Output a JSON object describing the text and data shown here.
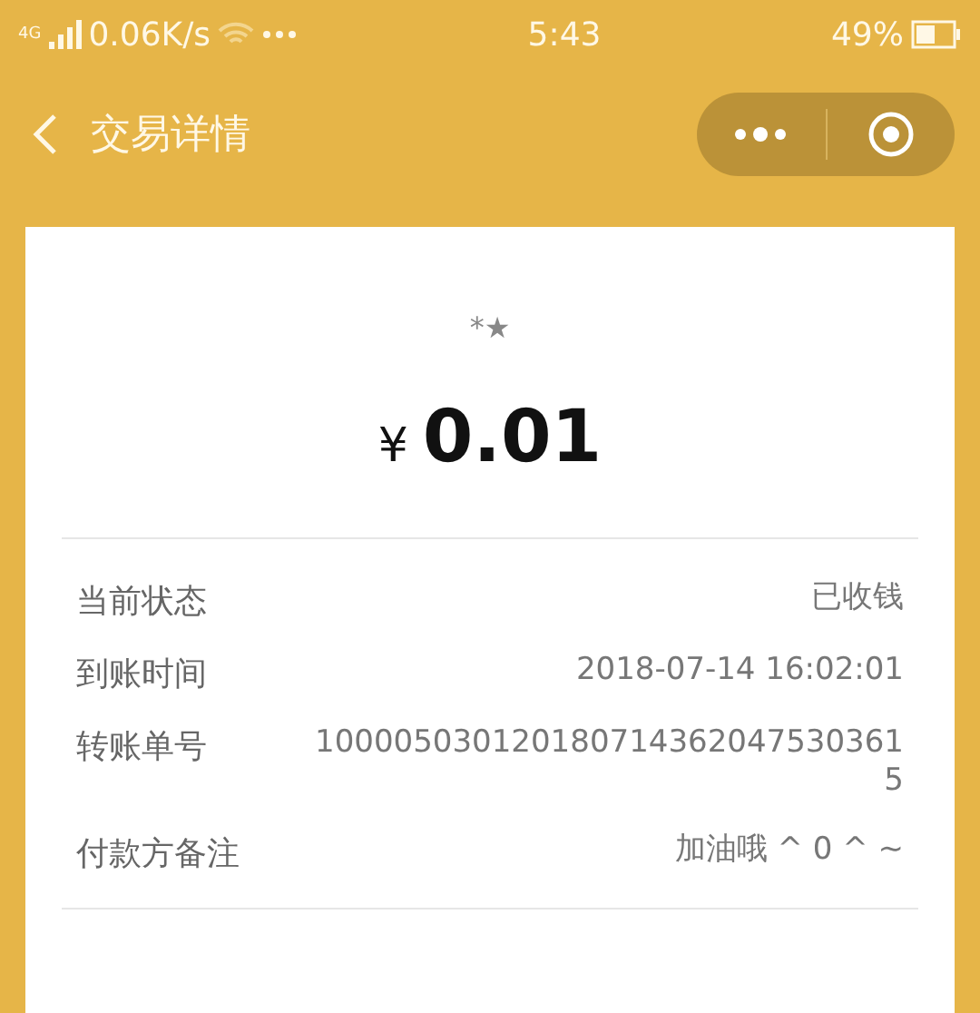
{
  "status_bar": {
    "network": "4G",
    "speed": "0.06K/s",
    "time": "5:43",
    "battery": "49%"
  },
  "nav": {
    "title": "交易详情"
  },
  "payee": {
    "name": "*★",
    "amount_currency": "¥",
    "amount": "0.01"
  },
  "details": [
    {
      "label": "当前状态",
      "value": "已收钱"
    },
    {
      "label": "到账时间",
      "value": "2018-07-14 16:02:01"
    },
    {
      "label": "转账单号",
      "value": "1000050301201807143620475303615"
    },
    {
      "label": "付款方备注",
      "value": "加油哦 ^ 0 ^ ~"
    }
  ]
}
